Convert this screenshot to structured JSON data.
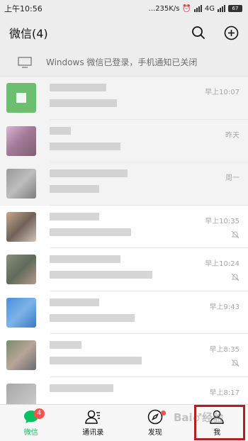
{
  "status_bar": {
    "time": "上午10:56",
    "net_speed": "...235K/s",
    "network": "4G",
    "battery": "67"
  },
  "header": {
    "title": "微信(4)",
    "search_icon": "search-icon",
    "add_icon": "plus-circle-icon"
  },
  "notice": {
    "icon": "monitor-icon",
    "text": "Windows 微信已登录，手机通知已关闭"
  },
  "chats": [
    {
      "time": "早上10:07",
      "muted": false
    },
    {
      "time": "昨天",
      "muted": false
    },
    {
      "time": "周一",
      "muted": false
    },
    {
      "time": "早上10:35",
      "muted": true
    },
    {
      "time": "早上10:24",
      "muted": true
    },
    {
      "time": "早上9:43",
      "muted": false
    },
    {
      "time": "早上8:35",
      "muted": true
    },
    {
      "time": "早上8:17",
      "muted": false
    }
  ],
  "nav": {
    "chats": {
      "label": "微信",
      "badge": "4"
    },
    "contacts": {
      "label": "通讯录"
    },
    "discover": {
      "label": "发现"
    },
    "me": {
      "label": "我"
    }
  },
  "colors": {
    "accent": "#07c160",
    "badge": "#fa5151",
    "highlight": "#b41e1e"
  },
  "watermark": "Bai♂经验"
}
